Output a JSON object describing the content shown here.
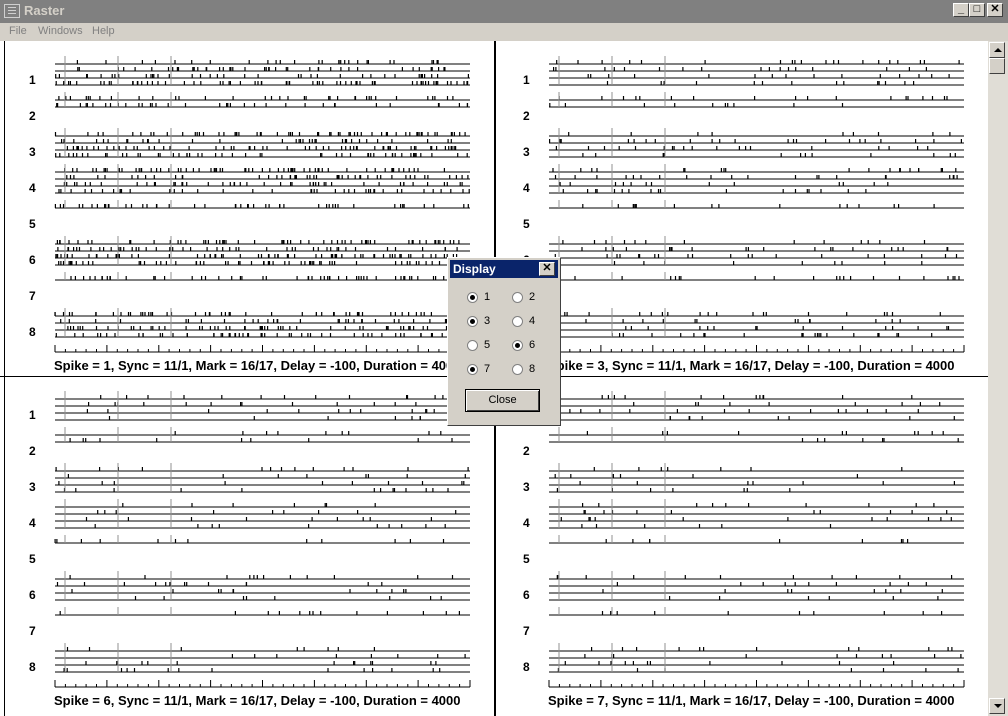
{
  "window": {
    "title": "Raster"
  },
  "title_buttons": {
    "minimize": "_",
    "maximize": "□",
    "close": "✕"
  },
  "menu": {
    "items": [
      "File",
      "Windows",
      "Help"
    ]
  },
  "row_labels": [
    "1",
    "2",
    "3",
    "4",
    "5",
    "6",
    "7",
    "8"
  ],
  "panels": [
    {
      "caption": "Spike = 1, Sync = 11/1, Mark = 16/17, Delay = -100, Duration = 4000",
      "density": 0.55
    },
    {
      "caption": "Spike = 3, Sync = 11/1, Mark = 16/17, Delay = -100, Duration = 4000",
      "density": 0.18
    },
    {
      "caption": "Spike = 6, Sync = 11/1, Mark = 16/17, Delay = -100, Duration = 4000",
      "density": 0.12
    },
    {
      "caption": "Spike = 7, Sync = 11/1, Mark = 16/17, Delay = -100, Duration = 4000",
      "density": 0.12
    }
  ],
  "dialog": {
    "title": "Display",
    "close_icon": "✕",
    "options": [
      {
        "label": "1",
        "checked": true
      },
      {
        "label": "2",
        "checked": false
      },
      {
        "label": "3",
        "checked": true
      },
      {
        "label": "4",
        "checked": false
      },
      {
        "label": "5",
        "checked": false
      },
      {
        "label": "6",
        "checked": true
      },
      {
        "label": "7",
        "checked": true
      },
      {
        "label": "8",
        "checked": false
      }
    ],
    "close_label": "Close"
  }
}
